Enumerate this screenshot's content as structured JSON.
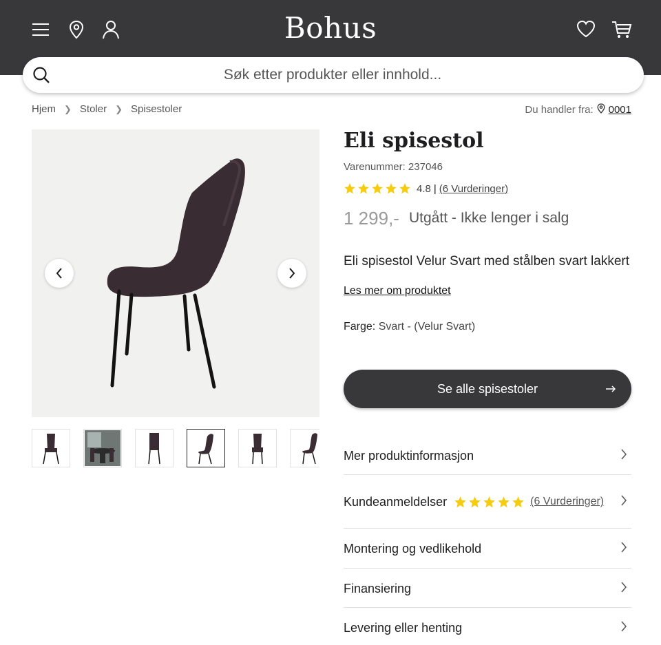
{
  "header": {
    "logo": "Bohus",
    "bg_color": "#38383b",
    "left_icons": [
      "menu-icon",
      "location-pin-icon",
      "user-icon"
    ],
    "right_icons": [
      "heart-icon",
      "cart-icon"
    ]
  },
  "search": {
    "placeholder": "Søk etter produkter eller innhold..."
  },
  "breadcrumb": [
    "Hjem",
    "Stoler",
    "Spisestoler"
  ],
  "store": {
    "label": "Du handler fra:",
    "code": "0001"
  },
  "gallery": {
    "thumbnail_count": 6,
    "active_thumbnail": 4
  },
  "product": {
    "title": "Eli spisestol",
    "sku": "Varenummer: 237046",
    "rating_value": "4.8",
    "rating_sep": "|",
    "rating_link": "(6 Vurderinger)",
    "stars": 5,
    "price": "1 299,-",
    "status": "Utgått - Ikke lenger i salg",
    "description": "Eli spisestol Velur Svart med stålben svart lakkert",
    "read_more": "Les mer om produktet",
    "color_label": "Farge:",
    "color_value": "Svart - (Velur Svart)"
  },
  "cta": {
    "label": "Se alle spisestoler"
  },
  "accordion": [
    {
      "label": "Mer produktinformasjon"
    },
    {
      "label": "Kundeanmeldelser",
      "rating_link": "(6 Vurderinger)"
    },
    {
      "label": "Montering og vedlikehold"
    },
    {
      "label": "Finansiering"
    },
    {
      "label": "Levering eller henting"
    }
  ],
  "colors": {
    "star": "#f5cc10",
    "dark": "#38383b"
  }
}
